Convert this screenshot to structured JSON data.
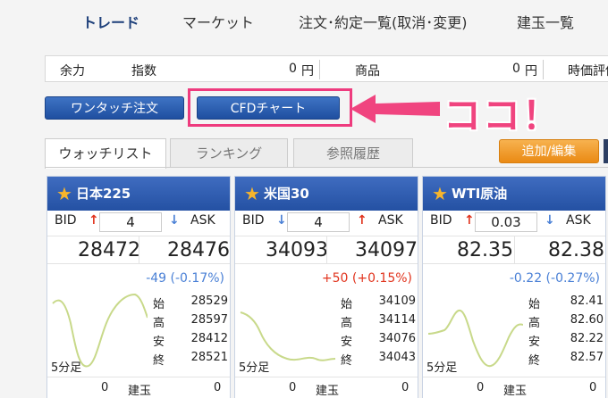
{
  "nav": {
    "trade": "トレード",
    "market": "マーケット",
    "orders": "注文･約定一覧(取消･変更)",
    "positions": "建玉一覧"
  },
  "info": {
    "margin_label": "余力",
    "index_label": "指数",
    "index_value": "0",
    "index_unit": "円",
    "commodity_label": "商品",
    "commodity_value": "0",
    "commodity_unit": "円",
    "valuation_label": "時価評価"
  },
  "buttons": {
    "one_touch": "ワンタッチ注文",
    "cfd_chart": "CFDチャート",
    "add_edit": "追加/編集"
  },
  "annotation": "ココ！",
  "tabs": [
    "ウォッチリスト",
    "ランキング",
    "参照履歴"
  ],
  "cards": [
    {
      "name": "日本225",
      "bid_label": "BID",
      "ask_label": "ASK",
      "spread": "4",
      "bid": "28472",
      "ask": "28476",
      "change": "-49 (-0.17%)",
      "change_dir": "neg",
      "ohlc": [
        [
          "始",
          "28529"
        ],
        [
          "高",
          "28597"
        ],
        [
          "安",
          "28412"
        ],
        [
          "終",
          "28521"
        ]
      ],
      "interval": "5分足",
      "pos_left": "0",
      "pos_label": "建玉",
      "pos_right": "0"
    },
    {
      "name": "米国30",
      "bid_label": "BID",
      "ask_label": "ASK",
      "spread": "4",
      "bid": "34093",
      "ask": "34097",
      "change": "+50 (+0.15%)",
      "change_dir": "pos",
      "ohlc": [
        [
          "始",
          "34109"
        ],
        [
          "高",
          "34114"
        ],
        [
          "安",
          "34076"
        ],
        [
          "終",
          "34043"
        ]
      ],
      "interval": "5分足",
      "pos_left": "0",
      "pos_label": "建玉",
      "pos_right": "0"
    },
    {
      "name": "WTI原油",
      "bid_label": "BID",
      "ask_label": "ASK",
      "spread": "0.03",
      "bid": "82.35",
      "ask": "82.38",
      "change": "-0.22 (-0.27%)",
      "change_dir": "neg",
      "ohlc": [
        [
          "始",
          "82.41"
        ],
        [
          "高",
          "82.60"
        ],
        [
          "安",
          "82.22"
        ],
        [
          "終",
          "82.57"
        ]
      ],
      "interval": "5分足",
      "pos_left": "0",
      "pos_label": "建玉",
      "pos_right": "0"
    }
  ],
  "colors": {
    "accent": "#1d3f7a",
    "highlight": "#ee3b7e",
    "orange": "#ea8a14",
    "up": "#e1341e",
    "down": "#4a80d6"
  }
}
